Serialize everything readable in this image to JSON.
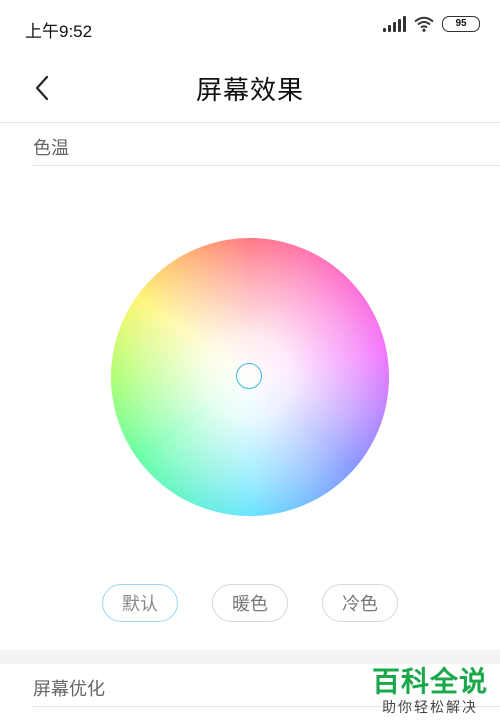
{
  "status_bar": {
    "time": "上午9:52",
    "battery": "95"
  },
  "header": {
    "title": "屏幕效果"
  },
  "color_temperature": {
    "label": "色温",
    "presets": [
      {
        "label": "默认",
        "selected": true
      },
      {
        "label": "暖色",
        "selected": false
      },
      {
        "label": "冷色",
        "selected": false
      }
    ]
  },
  "screen_optimization": {
    "label": "屏幕优化"
  },
  "watermark": {
    "title": "百科全说",
    "subtitle": "助你轻松解决"
  },
  "colors": {
    "accent": "#39b8e8",
    "watermark_green": "#1aa84a"
  },
  "icons": {
    "back": "chevron-left-icon",
    "signal": "signal-icon",
    "wifi": "wifi-icon",
    "battery": "battery-icon"
  }
}
